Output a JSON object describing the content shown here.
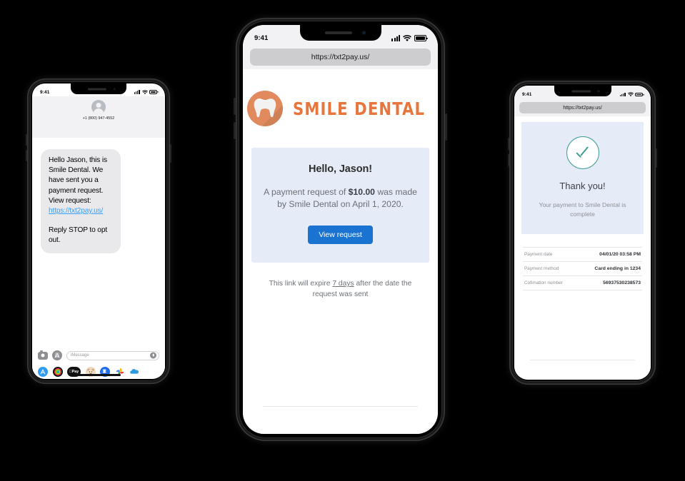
{
  "phone_left": {
    "name": "messages-phone",
    "status_bar": {
      "time": "9:41"
    },
    "conversation": {
      "contact_number": "+1 (800) 947-4552",
      "avatar_icon": "person-avatar-icon",
      "message_line1": "Hello Jason, this is Smile Dental. We have sent you a payment request. View request:",
      "message_link": "https://txt2pay.us/",
      "message_line2": "Reply STOP to opt out."
    },
    "tray": {
      "camera_icon": "camera-icon",
      "appstore_icon": "app-store-icon",
      "input_placeholder": "iMessage",
      "mic_icon": "microphone-icon",
      "apps": [
        {
          "name": "app-store-app-icon",
          "color": "#2f9cf4",
          "glyph": "A"
        },
        {
          "name": "activity-rings-app-icon",
          "color": "#111111",
          "glyph": ""
        },
        {
          "name": "apple-pay-app-icon",
          "color": "#111111",
          "glyph": "Pay"
        },
        {
          "name": "memoji-app-icon",
          "color": "#f0d8bf",
          "glyph": ""
        },
        {
          "name": "dropbox-app-icon",
          "color": "#1f6ef0",
          "glyph": ""
        },
        {
          "name": "google-photos-app-icon",
          "color": "#ffffff",
          "glyph": ""
        },
        {
          "name": "onedrive-app-icon",
          "color": "#2c9ae0",
          "glyph": ""
        }
      ]
    }
  },
  "phone_center": {
    "name": "payment-request-phone",
    "status_bar": {
      "time": "9:41"
    },
    "browser": {
      "url": "https://txt2pay.us/"
    },
    "brand": {
      "logo_icon": "tooth-logo-icon",
      "name": "SMILE DENTAL",
      "color": "#e8753c"
    },
    "payment_card": {
      "greeting": "Hello, Jason!",
      "body_prefix": "A payment request of ",
      "amount": "$10.00",
      "body_middle": " was made by Smile Dental on April 1, 2020.",
      "button_label": "View request",
      "button_color": "#1a73d1",
      "card_color": "#e5ecf8"
    },
    "expiry_note": {
      "prefix": "This link will expire ",
      "duration": "7 days",
      "suffix": " after the date the request was sent"
    }
  },
  "phone_right": {
    "name": "payment-confirmation-phone",
    "status_bar": {
      "time": "9:41"
    },
    "browser": {
      "url": "https://txt2pay.us/"
    },
    "confirmation": {
      "check_icon": "check-circle-icon",
      "check_color": "#3d9c96",
      "title": "Thank you!",
      "subtitle": "Your payment to Smile Dental is complete",
      "card_color": "#e5ecf8"
    },
    "receipt": {
      "rows": [
        {
          "label": "Payment date",
          "value": "04/01/20 03:58 PM"
        },
        {
          "label": "Payment method",
          "value": "Card ending in 1234"
        },
        {
          "label": "Cofimation number",
          "value": "56937530238573"
        }
      ]
    }
  }
}
